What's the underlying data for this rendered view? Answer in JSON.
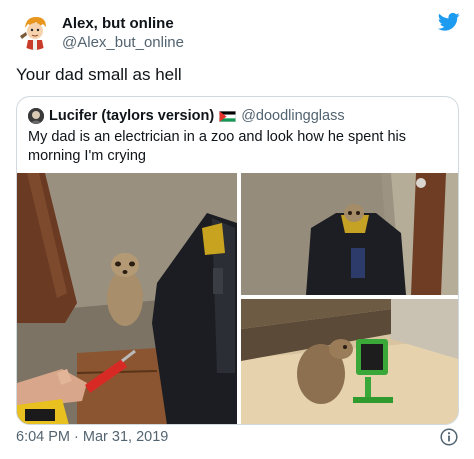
{
  "tweet": {
    "author": {
      "display_name": "Alex, but online",
      "handle": "@Alex_but_online",
      "avatar_icon": "cartoon-avatar-icon"
    },
    "text": "Your dad small as hell",
    "timestamp": "6:04 PM · Mar 31, 2019",
    "brand_color": "#1d9bf0",
    "logo_icon": "twitter-bird-icon",
    "info_icon": "info-icon"
  },
  "quoted": {
    "author": {
      "display_name": "Lucifer (taylors version)",
      "flag_icon": "palestine-flag-icon",
      "handle": "@doodlingglass"
    },
    "text": "My dad is an electrician in a zoo and look how he spent his morning I'm crying",
    "photos": [
      {
        "name": "photo-meerkat-screwdriver"
      },
      {
        "name": "photo-meerkat-in-tool-bag"
      },
      {
        "name": "photo-meerkat-with-work-light"
      }
    ]
  },
  "colors": {
    "text": "#0f1419",
    "secondary": "#536471",
    "border": "#cfd9de"
  }
}
